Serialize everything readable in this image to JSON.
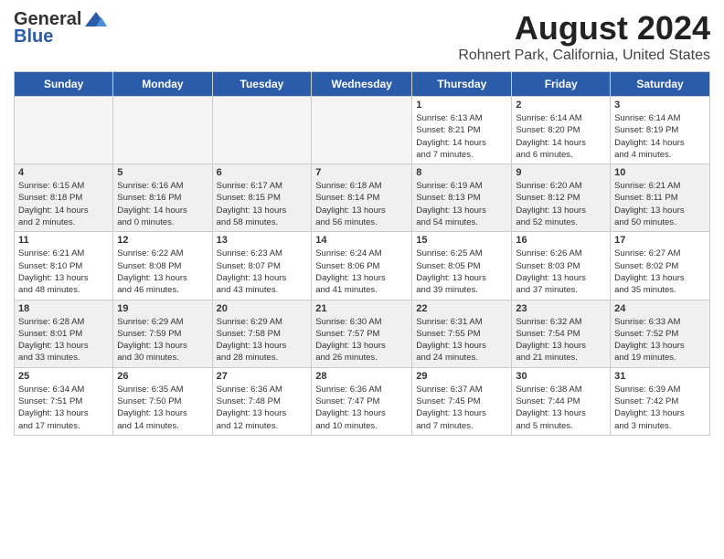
{
  "header": {
    "logo_general": "General",
    "logo_blue": "Blue",
    "month_title": "August 2024",
    "location": "Rohnert Park, California, United States"
  },
  "days_of_week": [
    "Sunday",
    "Monday",
    "Tuesday",
    "Wednesday",
    "Thursday",
    "Friday",
    "Saturday"
  ],
  "weeks": [
    [
      {
        "day": "",
        "info": ""
      },
      {
        "day": "",
        "info": ""
      },
      {
        "day": "",
        "info": ""
      },
      {
        "day": "",
        "info": ""
      },
      {
        "day": "1",
        "info": "Sunrise: 6:13 AM\nSunset: 8:21 PM\nDaylight: 14 hours\nand 7 minutes."
      },
      {
        "day": "2",
        "info": "Sunrise: 6:14 AM\nSunset: 8:20 PM\nDaylight: 14 hours\nand 6 minutes."
      },
      {
        "day": "3",
        "info": "Sunrise: 6:14 AM\nSunset: 8:19 PM\nDaylight: 14 hours\nand 4 minutes."
      }
    ],
    [
      {
        "day": "4",
        "info": "Sunrise: 6:15 AM\nSunset: 8:18 PM\nDaylight: 14 hours\nand 2 minutes."
      },
      {
        "day": "5",
        "info": "Sunrise: 6:16 AM\nSunset: 8:16 PM\nDaylight: 14 hours\nand 0 minutes."
      },
      {
        "day": "6",
        "info": "Sunrise: 6:17 AM\nSunset: 8:15 PM\nDaylight: 13 hours\nand 58 minutes."
      },
      {
        "day": "7",
        "info": "Sunrise: 6:18 AM\nSunset: 8:14 PM\nDaylight: 13 hours\nand 56 minutes."
      },
      {
        "day": "8",
        "info": "Sunrise: 6:19 AM\nSunset: 8:13 PM\nDaylight: 13 hours\nand 54 minutes."
      },
      {
        "day": "9",
        "info": "Sunrise: 6:20 AM\nSunset: 8:12 PM\nDaylight: 13 hours\nand 52 minutes."
      },
      {
        "day": "10",
        "info": "Sunrise: 6:21 AM\nSunset: 8:11 PM\nDaylight: 13 hours\nand 50 minutes."
      }
    ],
    [
      {
        "day": "11",
        "info": "Sunrise: 6:21 AM\nSunset: 8:10 PM\nDaylight: 13 hours\nand 48 minutes."
      },
      {
        "day": "12",
        "info": "Sunrise: 6:22 AM\nSunset: 8:08 PM\nDaylight: 13 hours\nand 46 minutes."
      },
      {
        "day": "13",
        "info": "Sunrise: 6:23 AM\nSunset: 8:07 PM\nDaylight: 13 hours\nand 43 minutes."
      },
      {
        "day": "14",
        "info": "Sunrise: 6:24 AM\nSunset: 8:06 PM\nDaylight: 13 hours\nand 41 minutes."
      },
      {
        "day": "15",
        "info": "Sunrise: 6:25 AM\nSunset: 8:05 PM\nDaylight: 13 hours\nand 39 minutes."
      },
      {
        "day": "16",
        "info": "Sunrise: 6:26 AM\nSunset: 8:03 PM\nDaylight: 13 hours\nand 37 minutes."
      },
      {
        "day": "17",
        "info": "Sunrise: 6:27 AM\nSunset: 8:02 PM\nDaylight: 13 hours\nand 35 minutes."
      }
    ],
    [
      {
        "day": "18",
        "info": "Sunrise: 6:28 AM\nSunset: 8:01 PM\nDaylight: 13 hours\nand 33 minutes."
      },
      {
        "day": "19",
        "info": "Sunrise: 6:29 AM\nSunset: 7:59 PM\nDaylight: 13 hours\nand 30 minutes."
      },
      {
        "day": "20",
        "info": "Sunrise: 6:29 AM\nSunset: 7:58 PM\nDaylight: 13 hours\nand 28 minutes."
      },
      {
        "day": "21",
        "info": "Sunrise: 6:30 AM\nSunset: 7:57 PM\nDaylight: 13 hours\nand 26 minutes."
      },
      {
        "day": "22",
        "info": "Sunrise: 6:31 AM\nSunset: 7:55 PM\nDaylight: 13 hours\nand 24 minutes."
      },
      {
        "day": "23",
        "info": "Sunrise: 6:32 AM\nSunset: 7:54 PM\nDaylight: 13 hours\nand 21 minutes."
      },
      {
        "day": "24",
        "info": "Sunrise: 6:33 AM\nSunset: 7:52 PM\nDaylight: 13 hours\nand 19 minutes."
      }
    ],
    [
      {
        "day": "25",
        "info": "Sunrise: 6:34 AM\nSunset: 7:51 PM\nDaylight: 13 hours\nand 17 minutes."
      },
      {
        "day": "26",
        "info": "Sunrise: 6:35 AM\nSunset: 7:50 PM\nDaylight: 13 hours\nand 14 minutes."
      },
      {
        "day": "27",
        "info": "Sunrise: 6:36 AM\nSunset: 7:48 PM\nDaylight: 13 hours\nand 12 minutes."
      },
      {
        "day": "28",
        "info": "Sunrise: 6:36 AM\nSunset: 7:47 PM\nDaylight: 13 hours\nand 10 minutes."
      },
      {
        "day": "29",
        "info": "Sunrise: 6:37 AM\nSunset: 7:45 PM\nDaylight: 13 hours\nand 7 minutes."
      },
      {
        "day": "30",
        "info": "Sunrise: 6:38 AM\nSunset: 7:44 PM\nDaylight: 13 hours\nand 5 minutes."
      },
      {
        "day": "31",
        "info": "Sunrise: 6:39 AM\nSunset: 7:42 PM\nDaylight: 13 hours\nand 3 minutes."
      }
    ]
  ]
}
